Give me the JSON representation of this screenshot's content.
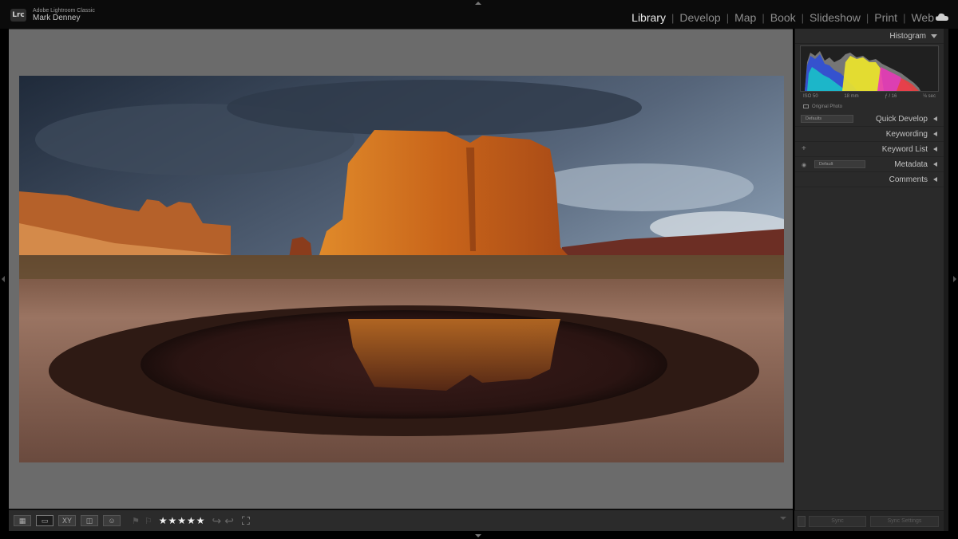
{
  "app": {
    "badge": "Lrc",
    "product_name": "Adobe Lightroom Classic",
    "user_name": "Mark Denney"
  },
  "modules": [
    {
      "label": "Library",
      "active": true
    },
    {
      "label": "Develop",
      "active": false
    },
    {
      "label": "Map",
      "active": false
    },
    {
      "label": "Book",
      "active": false
    },
    {
      "label": "Slideshow",
      "active": false
    },
    {
      "label": "Print",
      "active": false
    },
    {
      "label": "Web",
      "active": false
    }
  ],
  "module_separator": "|",
  "icons": {
    "cloud": "cloud-icon",
    "grid_view": "grid-view-icon",
    "loupe_view": "loupe-view-icon",
    "compare_view": "compare-view-icon",
    "survey_view": "survey-view-icon",
    "people_view": "people-view-icon",
    "crop": "crop-overlay-icon"
  },
  "toolbar": {
    "grid_glyph": "▦",
    "loupe_glyph": "▭",
    "compare_glyph": "XY",
    "survey_glyph": "◫",
    "people_glyph": "☺",
    "flag_pick": "⚑",
    "flag_reject": "⚐",
    "rating": "★★★★★",
    "rating_value": 5,
    "rotate_left": "↩",
    "rotate_right": "↪",
    "crop_glyph": "⛶"
  },
  "right_panel": {
    "histogram": {
      "title": "Histogram",
      "iso": "ISO 50",
      "focal_length": "18 mm",
      "aperture": "ƒ / 16",
      "shutter": "⅛ sec",
      "original_photo": "Original Photo"
    },
    "quick_develop": {
      "title": "Quick Develop",
      "preset": "Defaults"
    },
    "keywording": {
      "title": "Keywording"
    },
    "keyword_list": {
      "title": "Keyword List",
      "add": "+"
    },
    "metadata": {
      "title": "Metadata",
      "preset": "Default"
    },
    "comments": {
      "title": "Comments"
    }
  },
  "sync": {
    "sync_label": "Sync",
    "sync_settings_label": "Sync Settings"
  },
  "colors": {
    "active_module": "#e8e8e8",
    "inactive_module": "#8d8d8d",
    "background": "#6b6b6b",
    "panel": "#2a2a2a"
  }
}
